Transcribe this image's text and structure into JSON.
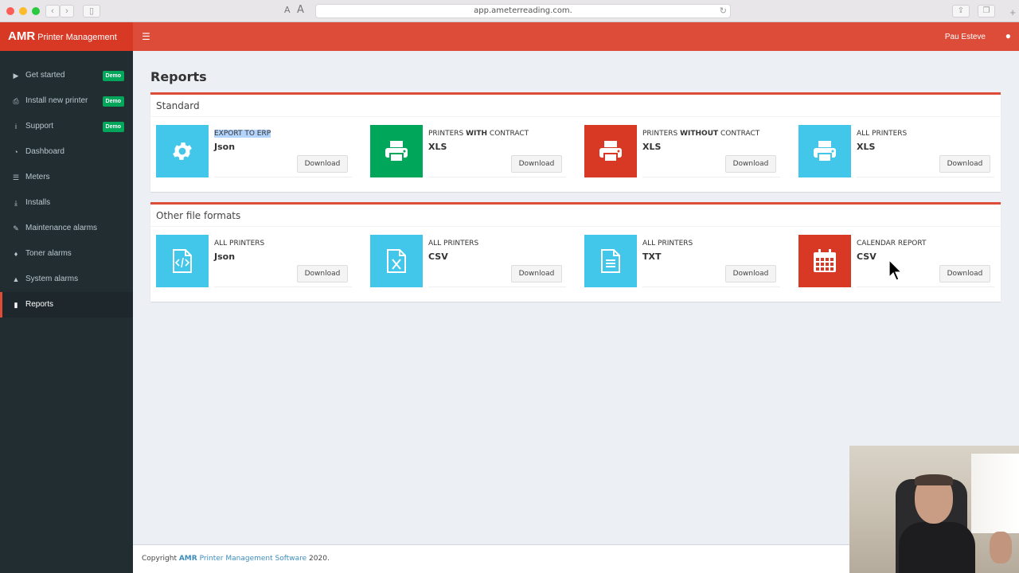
{
  "browser": {
    "url": "app.ameterreading.com.",
    "font_small": "A",
    "font_large": "A"
  },
  "header": {
    "brand_bold": "AMR",
    "brand_rest": "Printer Management",
    "user_name": "Pau Esteve"
  },
  "sidebar": {
    "items": [
      {
        "label": "Get started",
        "icon": "youtube-icon",
        "badge": "Demo"
      },
      {
        "label": "Install new printer",
        "icon": "printer-icon",
        "badge": "Demo"
      },
      {
        "label": "Support",
        "icon": "info-icon",
        "badge": "Demo"
      },
      {
        "label": "Dashboard",
        "icon": "dashboard-icon"
      },
      {
        "label": "Meters",
        "icon": "list-icon"
      },
      {
        "label": "Installs",
        "icon": "download-icon"
      },
      {
        "label": "Maintenance alarms",
        "icon": "wrench-icon"
      },
      {
        "label": "Toner alarms",
        "icon": "tint-icon"
      },
      {
        "label": "System alarms",
        "icon": "warning-icon"
      },
      {
        "label": "Reports",
        "icon": "file-icon",
        "active": true
      }
    ]
  },
  "page": {
    "title": "Reports"
  },
  "standard": {
    "title": "Standard",
    "cards": [
      {
        "label": "EXPORT TO ERP",
        "value": "Json",
        "button": "Download",
        "icon": "gear-icon",
        "color": "#42c7ea"
      },
      {
        "label_pre": "PRINTERS ",
        "label_bold": "WITH",
        "label_post": " CONTRACT",
        "value": "XLS",
        "button": "Download",
        "icon": "printer-icon",
        "color": "#00a65a"
      },
      {
        "label_pre": "PRINTERS ",
        "label_bold": "WITHOUT",
        "label_post": " CONTRACT",
        "value": "XLS",
        "button": "Download",
        "icon": "printer-icon",
        "color": "#d73925"
      },
      {
        "label": "ALL PRINTERS",
        "value": "XLS",
        "button": "Download",
        "icon": "printer-icon",
        "color": "#42c7ea"
      }
    ]
  },
  "other": {
    "title": "Other file formats",
    "cards": [
      {
        "label": "ALL PRINTERS",
        "value": "Json",
        "button": "Download",
        "icon": "file-code-icon",
        "color": "#42c7ea"
      },
      {
        "label": "ALL PRINTERS",
        "value": "CSV",
        "button": "Download",
        "icon": "file-excel-icon",
        "color": "#42c7ea"
      },
      {
        "label": "ALL PRINTERS",
        "value": "TXT",
        "button": "Download",
        "icon": "file-text-icon",
        "color": "#42c7ea"
      },
      {
        "label": "CALENDAR REPORT",
        "value": "CSV",
        "button": "Download",
        "icon": "calendar-icon",
        "color": "#d73925"
      }
    ]
  },
  "footer": {
    "pre": "Copyright ",
    "brand_bold": "AMR",
    "brand_rest": " Printer Management Software",
    "post": " 2020."
  }
}
